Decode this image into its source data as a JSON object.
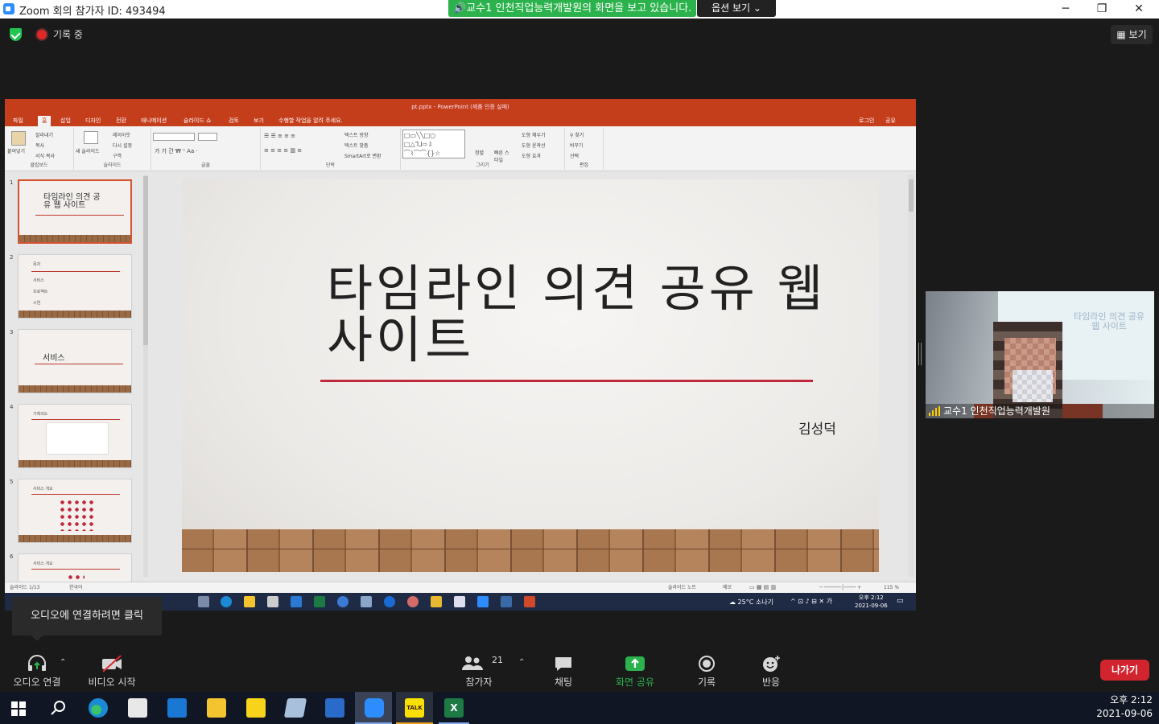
{
  "window": {
    "title": "Zoom 회의 참가자 ID: 493494",
    "minimize": "─",
    "maximize": "❐",
    "close": "✕"
  },
  "share_banner": {
    "text": "교수1 인천직업능력개발원의 화면을 보고 있습니다.",
    "options_label": "옵션 보기"
  },
  "recording": {
    "label": "기록 중"
  },
  "view_button": {
    "label": "보기"
  },
  "ppt": {
    "title": "pt.pptx - PowerPoint (제품 인증 실패)",
    "menu": [
      "파일",
      "홈",
      "삽입",
      "디자인",
      "전환",
      "애니메이션",
      "슬라이드 쇼",
      "검토",
      "보기",
      "수행할 작업을 알려 주세요."
    ],
    "menu_active": "홈",
    "login": "로그인",
    "share": "공유",
    "ribbon_groups": [
      "클립보드",
      "슬라이드",
      "글꼴",
      "단락",
      "그리기",
      "편집"
    ],
    "ribbon_buttons": {
      "paste": "붙여넣기",
      "cut": "잘라내기",
      "copy": "복사",
      "format_copy": "서식 복사",
      "new_slide": "새 슬라이드",
      "layout": "레이아웃",
      "reset": "다시 설정",
      "section": "구역",
      "text_direction": "텍스트 방향",
      "text_align": "텍스트 맞춤",
      "smartart": "SmartArt로 변환",
      "arrange": "정렬",
      "quick_style": "빠른 스타일",
      "shape_fill": "도형 채우기",
      "shape_outline": "도형 윤곽선",
      "shape_effect": "도형 효과",
      "find": "찾기",
      "replace": "바꾸기",
      "select": "선택"
    },
    "thumbnails": [
      {
        "num": "1",
        "title": "타임라인 의견 공유 웹 사이트"
      },
      {
        "num": "2",
        "title": "목차",
        "items": [
          "서비스",
          "프로젝트",
          "시연"
        ]
      },
      {
        "num": "3",
        "title": "서비스"
      },
      {
        "num": "4",
        "title": "기획의도"
      },
      {
        "num": "5",
        "title": "서비스 개요"
      },
      {
        "num": "6",
        "title": "서비스 개요"
      }
    ],
    "slide": {
      "title_line1": "타임라인 의견 공유 웹",
      "title_line2": "사이트",
      "author": "김성덕"
    },
    "status": {
      "slide_count": "슬라이드 1/13",
      "language": "한국어",
      "notes": "슬라이드 노트",
      "memo": "메모",
      "zoom": "115 %"
    },
    "remote_taskbar": {
      "weather": "25°C 소나기",
      "ime": "가",
      "time": "오후 2:12",
      "date": "2021-09-06"
    }
  },
  "video": {
    "name": "교수1 인천직업능력개발원",
    "screen_text": "타임라인 의견 공유 웹 사이트"
  },
  "audio_tip": {
    "text": "오디오에 연결하려면 클릭"
  },
  "controls": {
    "audio": "오디오 연결",
    "video": "비디오 시작",
    "participants": "참가자",
    "participant_count": "21",
    "chat": "채팅",
    "share": "화면 공유",
    "record": "기록",
    "reactions": "반응",
    "leave": "나가기"
  },
  "taskbar": {
    "time": "오후 2:12",
    "date": "2021-09-06"
  },
  "colors": {
    "zoom_green": "#2bb24c",
    "ppt_red": "#c43e1c",
    "leave_red": "#d1242e",
    "slide_accent": "#c0283c"
  }
}
